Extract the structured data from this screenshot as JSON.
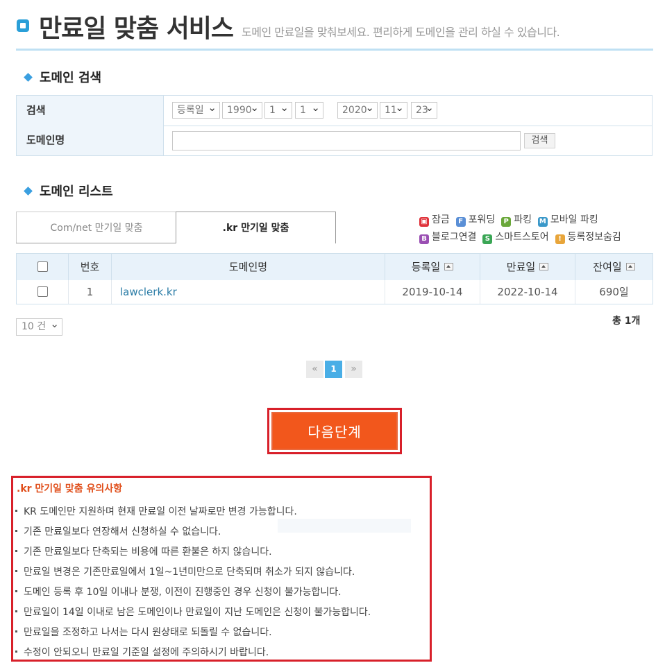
{
  "header": {
    "title": "만료일 맞춤 서비스",
    "subtitle": "도메인 만료일을 맞춰보세요. 편리하게 도메인을 관리 하실 수 있습니다."
  },
  "search_section": {
    "title": "도메인 검색",
    "row_search_label": "검색",
    "row_domain_label": "도메인명",
    "date_type": "등록일",
    "from_year": "1990",
    "from_month": "1",
    "from_day": "1",
    "tilde": "~",
    "to_year": "2020",
    "to_month": "11",
    "to_day": "23",
    "domain_input_value": "",
    "search_button": "검색"
  },
  "list_section": {
    "title": "도메인 리스트",
    "tabs": [
      "Com/net 만기일 맞춤",
      ".kr 만기일 맞춤"
    ],
    "active_tab": 1,
    "legend": [
      {
        "icon": "lock-icon",
        "letter": "🔒",
        "label": "잠금",
        "color": "#e0333b"
      },
      {
        "icon": "forwarding-icon",
        "letter": "F",
        "label": "포워딩",
        "color": "#5a8fd6"
      },
      {
        "icon": "parking-icon",
        "letter": "P",
        "label": "파킹",
        "color": "#6aa83a"
      },
      {
        "icon": "mobile-parking-icon",
        "letter": "M",
        "label": "모바일 파킹",
        "color": "#3a98c9"
      },
      {
        "icon": "blog-icon",
        "letter": "B",
        "label": "블로그연결",
        "color": "#9a4fb3"
      },
      {
        "icon": "smartstore-icon",
        "letter": "S",
        "label": "스마트스토어",
        "color": "#3aa655"
      },
      {
        "icon": "privacy-icon",
        "letter": "!",
        "label": "등록정보숨김",
        "color": "#e8a53a"
      }
    ],
    "columns": [
      "",
      "번호",
      "도메인명",
      "등록일",
      "만료일",
      "잔여일"
    ],
    "rows": [
      {
        "no": "1",
        "domain": "lawclerk.kr",
        "registered": "2019-10-14",
        "expires": "2022-10-14",
        "remaining": "690일"
      }
    ],
    "per_page": "10 건",
    "total": "총 1개"
  },
  "pagination": {
    "prev": "«",
    "current": "1",
    "next": "»"
  },
  "next_button": "다음단계",
  "notice": {
    "title": ".kr 만기일 맞춤 유의사항",
    "items": [
      "KR 도메인만 지원하며 현재 만료일 이전 날짜로만 변경 가능합니다.",
      "기존 만료일보다 연장해서 신청하실 수 없습니다.",
      "기존 만료일보다 단축되는 비용에 따른 환불은 하지 않습니다.",
      "만료일 변경은 기존만료일에서 1일~1년미만으로 단축되며 취소가 되지 않습니다.",
      "도메인 등록 후 10일 이내나 분쟁, 이전이 진행중인 경우 신청이 불가능합니다.",
      "만료일이 14일 이내로 남은 도메인이나 만료일이 지난 도메인은 신청이 불가능합니다.",
      "만료일을 조정하고 나서는 다시 원상태로 되돌릴 수 없습니다.",
      "수정이 안되오니 만료일 기준일 설정에 주의하시기 바랍니다."
    ]
  }
}
